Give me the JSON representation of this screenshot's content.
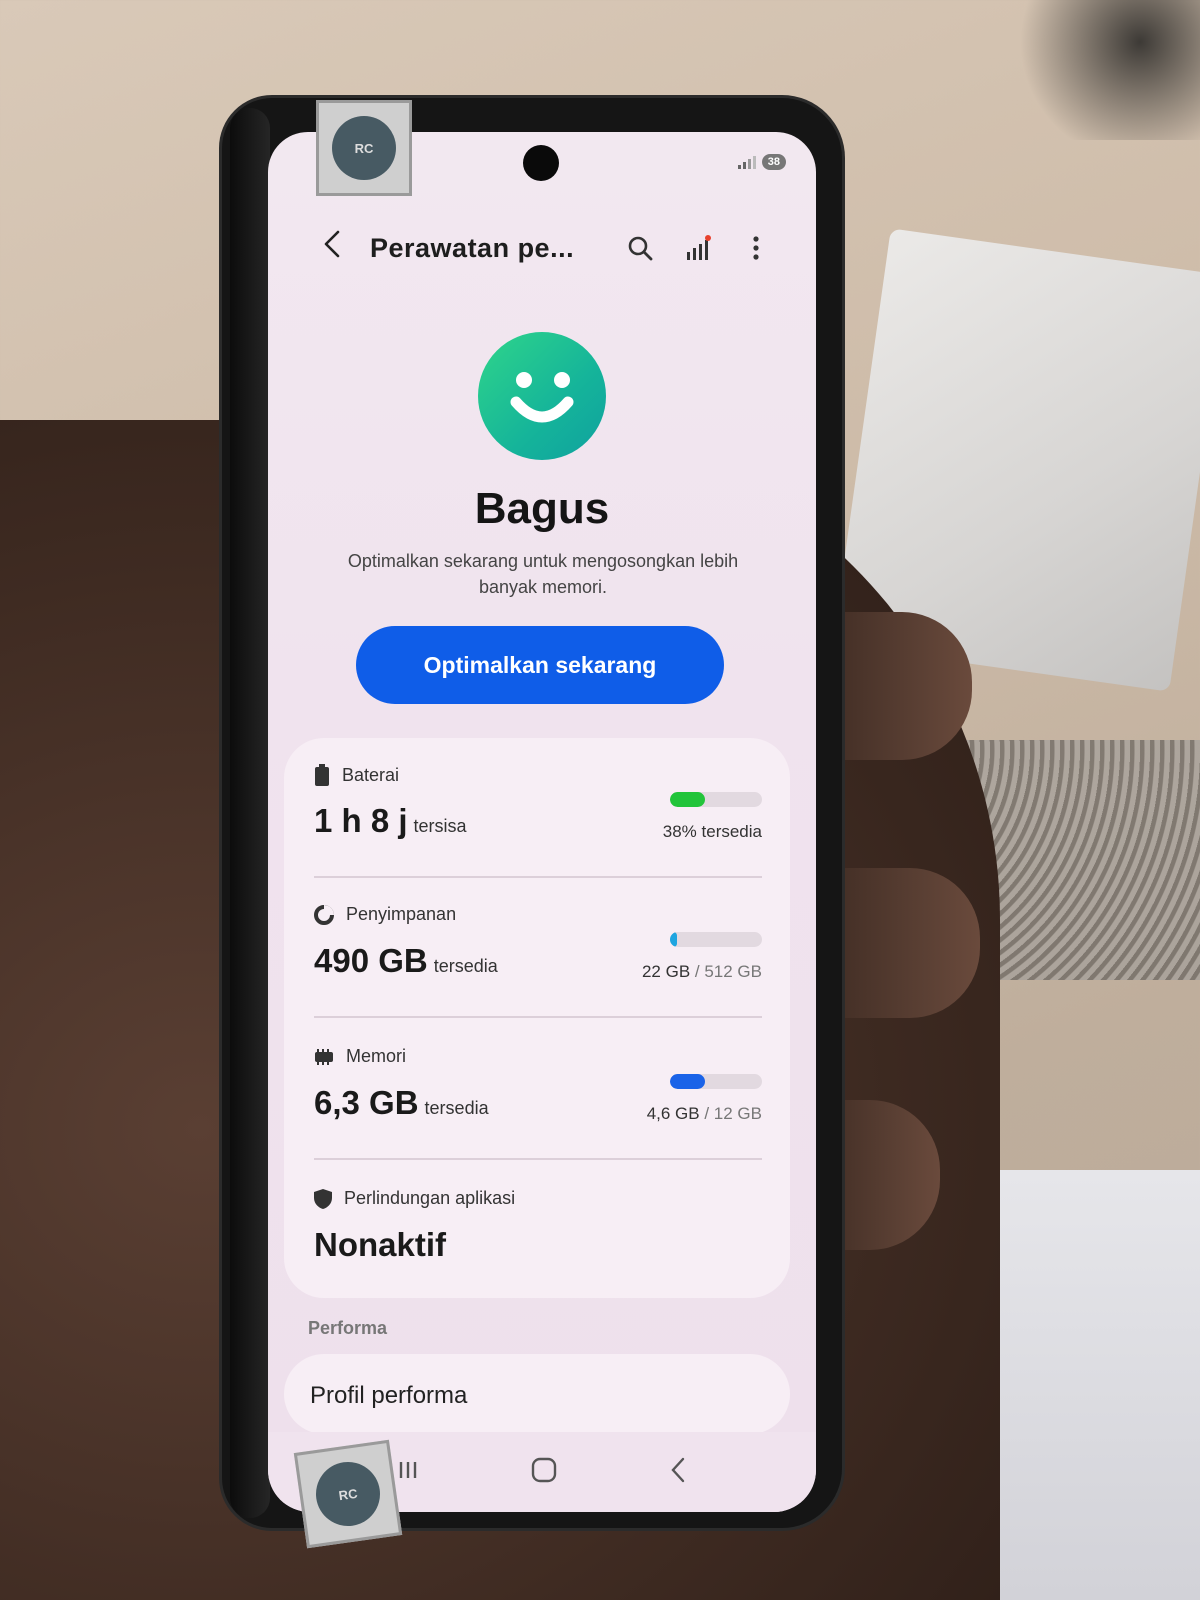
{
  "header": {
    "title": "Perawatan pe...",
    "back_icon": "back-arrow-icon",
    "search_icon": "search-icon",
    "stats_icon": "bar-chart-icon",
    "more_icon": "more-vertical-icon"
  },
  "status_bar": {
    "battery": "38"
  },
  "summary": {
    "status_word": "Bagus",
    "description": "Optimalkan sekarang untuk mengosongkan lebih banyak memori.",
    "button_label": "Optimalkan sekarang"
  },
  "items": [
    {
      "label": "Baterai",
      "icon": "battery-icon",
      "main_value": "1 h 8 j",
      "main_suffix": "tersisa",
      "right_primary": "38% tersedia",
      "right_secondary": "",
      "bar_fraction": 0.38,
      "bar_color": "#22c43a"
    },
    {
      "label": "Penyimpanan",
      "icon": "storage-pie-icon",
      "main_value": "490 GB",
      "main_suffix": "tersedia",
      "right_primary": "22 GB",
      "right_secondary": " / 512 GB",
      "bar_fraction": 0.04,
      "bar_color": "#1ea5e0"
    },
    {
      "label": "Memori",
      "icon": "memory-chip-icon",
      "main_value": "6,3 GB",
      "main_suffix": "tersedia",
      "right_primary": "4,6 GB",
      "right_secondary": " / 12 GB",
      "bar_fraction": 0.38,
      "bar_color": "#1a63e8"
    },
    {
      "label": "Perlindungan aplikasi",
      "icon": "shield-icon",
      "main_value": "Nonaktif",
      "main_suffix": ""
    }
  ],
  "performance": {
    "section_title": "Performa",
    "profile_label": "Profil performa"
  },
  "colors": {
    "accent": "#0f5de8",
    "smiley_start": "#2fd58a",
    "smiley_end": "#0fa19f"
  }
}
